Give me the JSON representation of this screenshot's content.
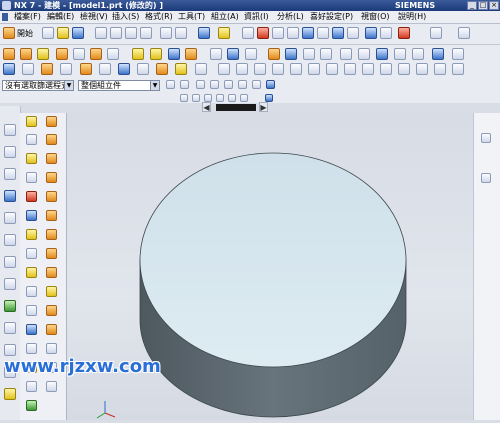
{
  "window": {
    "title": "NX 7 - 建模 - [model1.prt (修改的) ]",
    "brand": "SIEMENS",
    "controls": [
      "_",
      "□",
      "×"
    ]
  },
  "menubar": {
    "items": [
      "檔案(F)",
      "編輯(E)",
      "檢視(V)",
      "插入(S)",
      "格式(R)",
      "工具(T)",
      "組立(A)",
      "資訊(I)",
      "分析(L)",
      "喜好設定(P)",
      "視窗(O)",
      "說明(H)"
    ]
  },
  "toolbar1": {
    "start_label": "開始"
  },
  "selection_bar": {
    "filter_value": "沒有選取篩選程式",
    "scope_value": "整個組立件"
  },
  "watermark": {
    "text": "www.rjzxw.com"
  },
  "colors": {
    "cylinder_top": "#d8e7ef",
    "cylinder_side": "#5e6a72",
    "background": "#dde1e8",
    "title_bar": "#1b3a7a"
  }
}
